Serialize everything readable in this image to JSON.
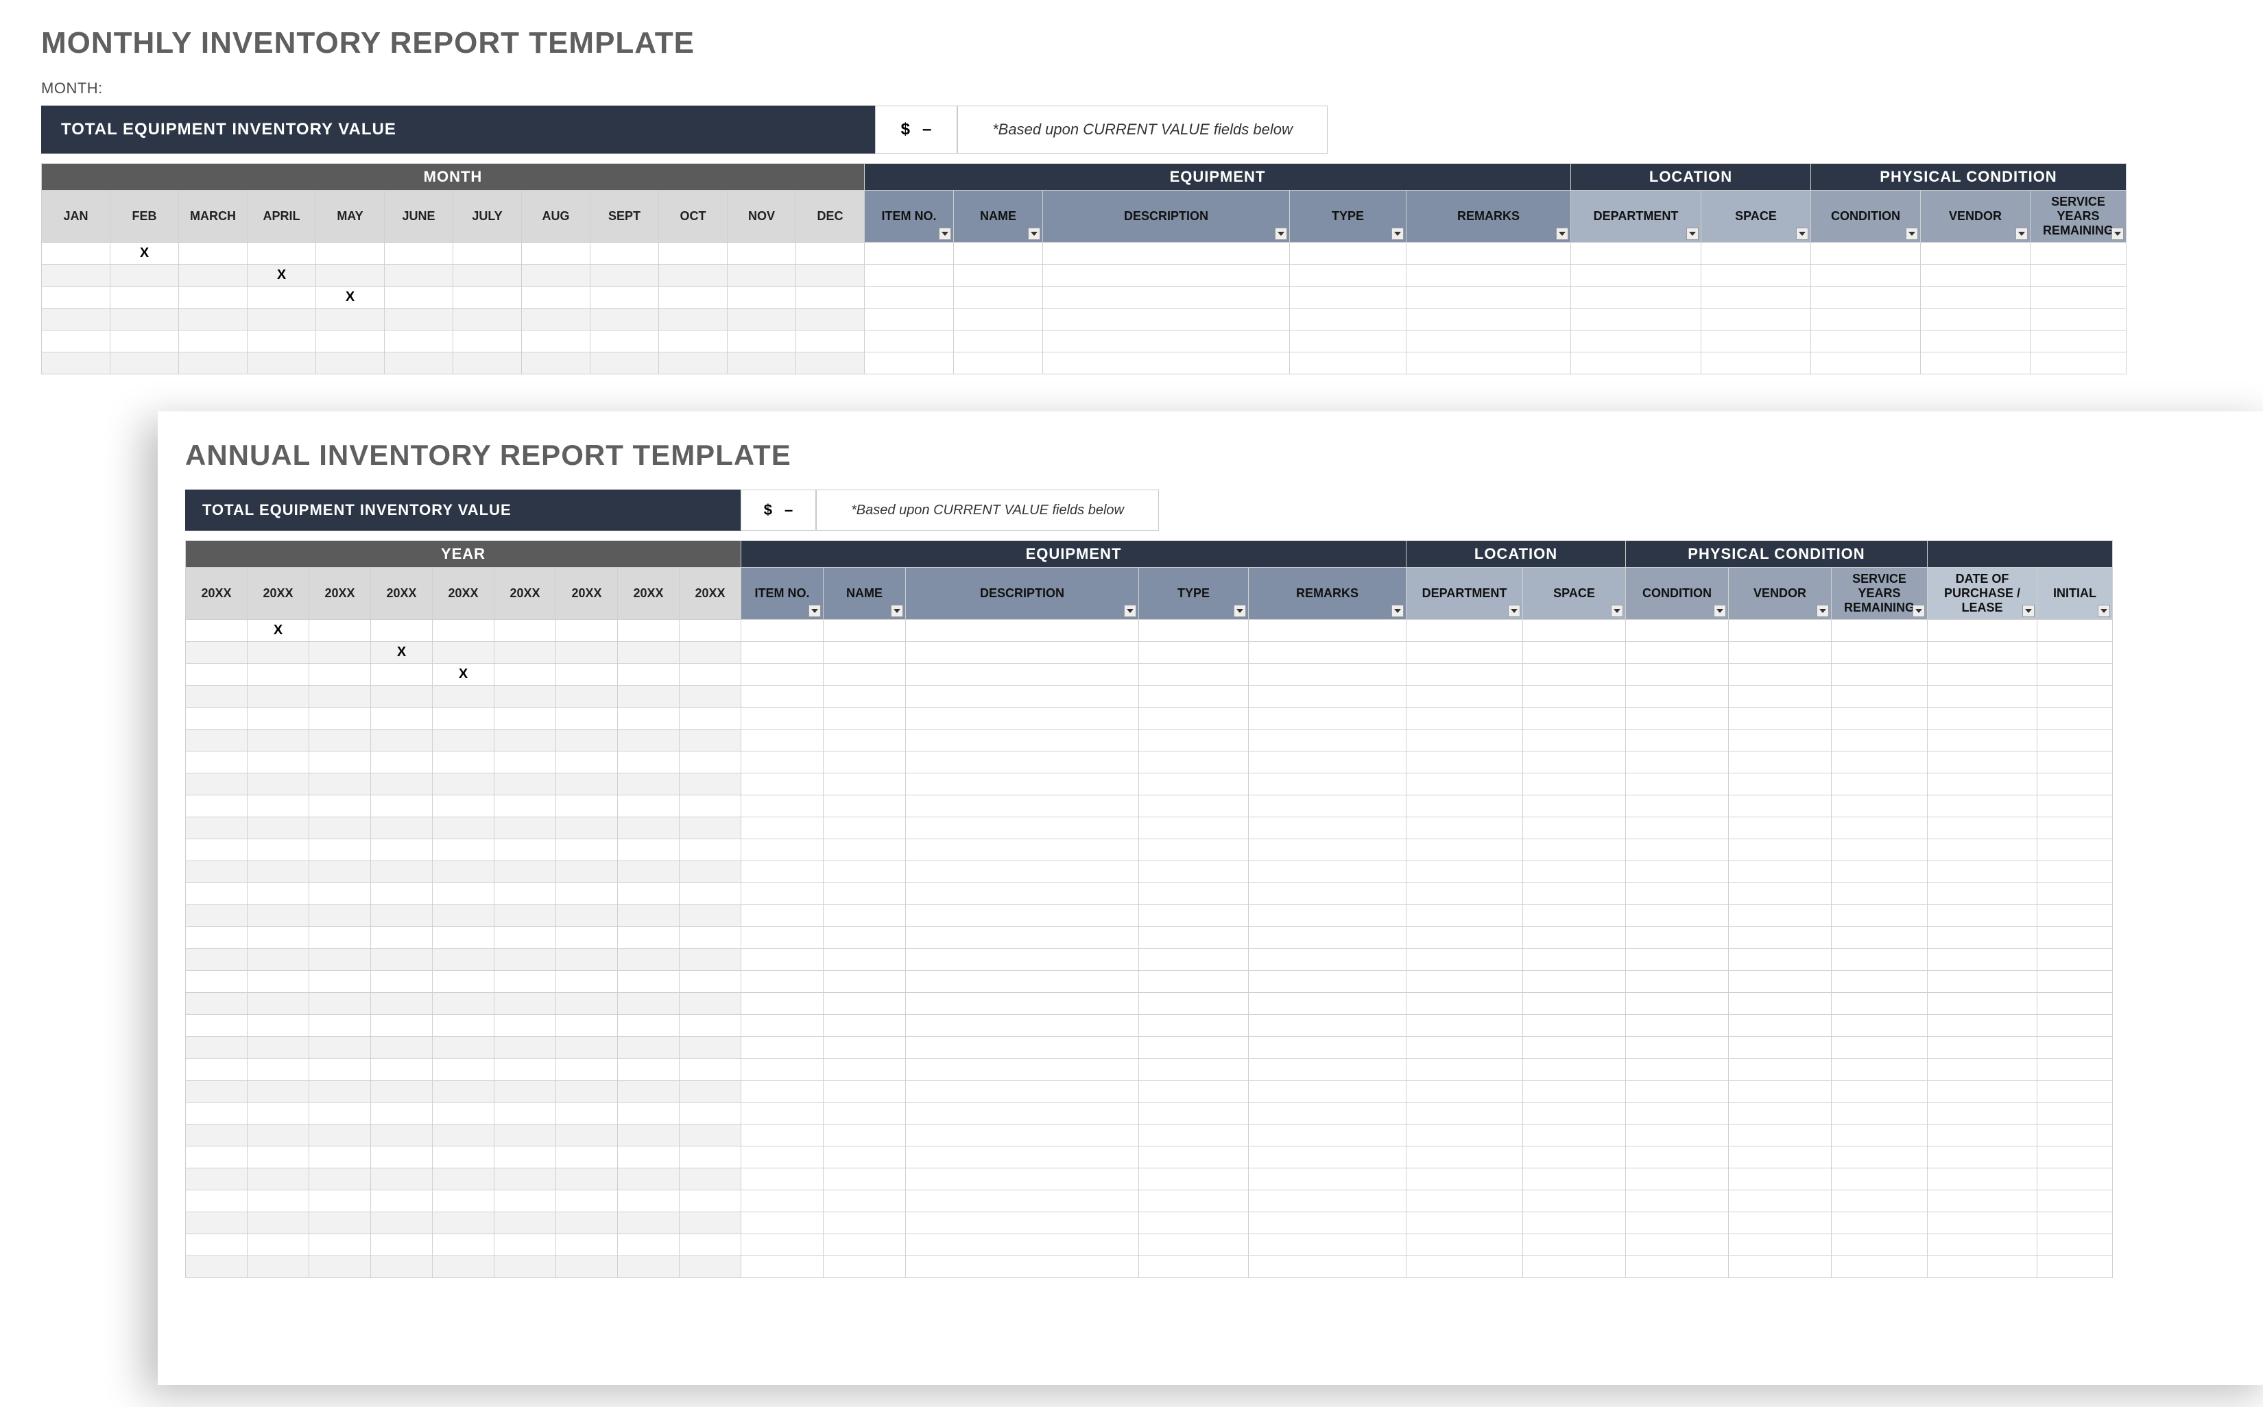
{
  "monthly": {
    "title": "MONTHLY INVENTORY REPORT TEMPLATE",
    "month_label": "MONTH:",
    "total_label": "TOTAL EQUIPMENT INVENTORY VALUE",
    "total_currency": "$",
    "total_value": "–",
    "total_note": "*Based upon CURRENT VALUE fields below",
    "group_headers": {
      "period": "MONTH",
      "equip": "EQUIPMENT",
      "loc": "LOCATION",
      "cond": "PHYSICAL CONDITION"
    },
    "months": [
      "JAN",
      "FEB",
      "MARCH",
      "APRIL",
      "MAY",
      "JUNE",
      "JULY",
      "AUG",
      "SEPT",
      "OCT",
      "NOV",
      "DEC"
    ],
    "equip_cols": [
      "ITEM NO.",
      "NAME",
      "DESCRIPTION",
      "TYPE",
      "REMARKS"
    ],
    "loc_cols": [
      "DEPARTMENT",
      "SPACE"
    ],
    "cond_cols": [
      "CONDITION",
      "VENDOR",
      "SERVICE YEARS REMAINING"
    ],
    "rows": [
      {
        "mark_col": 1
      },
      {
        "mark_col": 3
      },
      {
        "mark_col": 4
      },
      {
        "mark_col": null
      },
      {
        "mark_col": null
      },
      {
        "mark_col": null
      }
    ],
    "mark": "X"
  },
  "annual": {
    "title": "ANNUAL INVENTORY REPORT TEMPLATE",
    "total_label": "TOTAL EQUIPMENT INVENTORY VALUE",
    "total_currency": "$",
    "total_value": "–",
    "total_note": "*Based upon CURRENT VALUE fields below",
    "group_headers": {
      "period": "YEAR",
      "equip": "EQUIPMENT",
      "loc": "LOCATION",
      "cond": "PHYSICAL CONDITION"
    },
    "years": [
      "20XX",
      "20XX",
      "20XX",
      "20XX",
      "20XX",
      "20XX",
      "20XX",
      "20XX",
      "20XX"
    ],
    "equip_cols": [
      "ITEM NO.",
      "NAME",
      "DESCRIPTION",
      "TYPE",
      "REMARKS"
    ],
    "loc_cols": [
      "DEPARTMENT",
      "SPACE"
    ],
    "cond_cols": [
      "CONDITION",
      "VENDOR",
      "SERVICE YEARS REMAINING"
    ],
    "extra_cols": [
      "DATE OF PURCHASE / LEASE",
      "INITIAL"
    ],
    "rows_count": 30,
    "marks": [
      {
        "row": 0,
        "col": 1
      },
      {
        "row": 1,
        "col": 3
      },
      {
        "row": 2,
        "col": 4
      }
    ],
    "mark": "X"
  }
}
